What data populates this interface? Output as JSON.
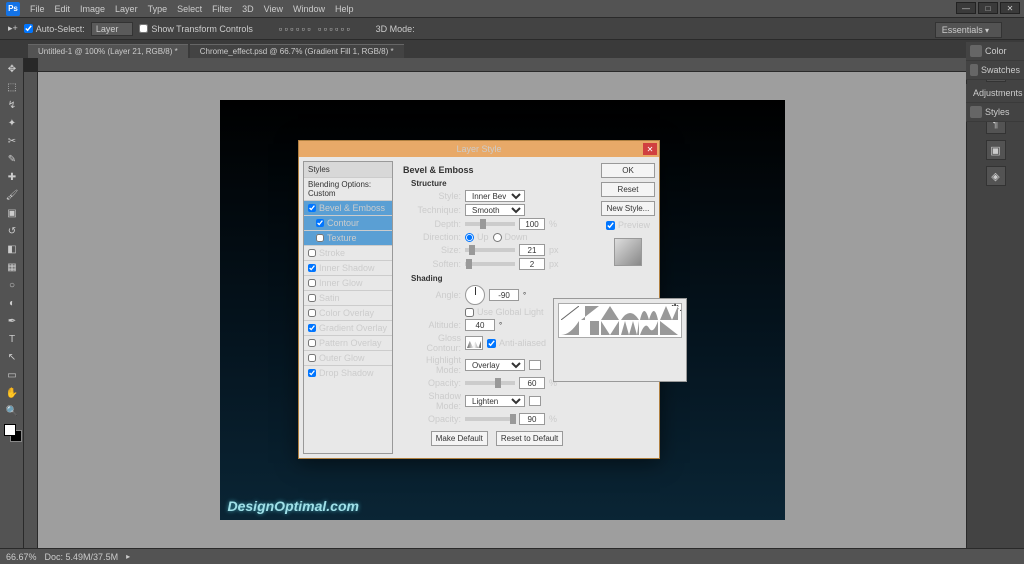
{
  "app": {
    "name": "Ps"
  },
  "menu": [
    "File",
    "Edit",
    "Image",
    "Layer",
    "Type",
    "Select",
    "Filter",
    "3D",
    "View",
    "Window",
    "Help"
  ],
  "optbar": {
    "auto_select": "Auto-Select:",
    "target": "Layer",
    "show_transform": "Show Transform Controls",
    "mode_3d": "3D Mode:"
  },
  "tabs": [
    "Untitled-1 @ 100% (Layer 21, RGB/8) *",
    "Chrome_effect.psd @ 66.7% (Gradient Fill 1, RGB/8) *"
  ],
  "essentials": "Essentials",
  "panels": [
    "Color",
    "Swatches",
    "Adjustments",
    "Styles"
  ],
  "watermark": "DesignOptimal.com",
  "status": {
    "zoom": "66.67%",
    "doc": "Doc: 5.49M/37.5M"
  },
  "dialog": {
    "title": "Layer Style",
    "left_header": "Styles",
    "blending": "Blending Options: Custom",
    "items": [
      {
        "label": "Bevel & Emboss",
        "checked": true,
        "selected": true
      },
      {
        "label": "Contour",
        "checked": true,
        "indent": true
      },
      {
        "label": "Texture",
        "checked": false,
        "indent": true
      },
      {
        "label": "Stroke",
        "checked": false
      },
      {
        "label": "Inner Shadow",
        "checked": true
      },
      {
        "label": "Inner Glow",
        "checked": false
      },
      {
        "label": "Satin",
        "checked": false
      },
      {
        "label": "Color Overlay",
        "checked": false
      },
      {
        "label": "Gradient Overlay",
        "checked": true
      },
      {
        "label": "Pattern Overlay",
        "checked": false
      },
      {
        "label": "Outer Glow",
        "checked": false
      },
      {
        "label": "Drop Shadow",
        "checked": true
      }
    ],
    "section": "Bevel & Emboss",
    "structure_hdr": "Structure",
    "style_lbl": "Style:",
    "style_val": "Inner Bevel",
    "tech_lbl": "Technique:",
    "tech_val": "Smooth",
    "depth_lbl": "Depth:",
    "depth_val": "100",
    "depth_unit": "%",
    "dir_lbl": "Direction:",
    "dir_up": "Up",
    "dir_down": "Down",
    "size_lbl": "Size:",
    "size_val": "21",
    "size_unit": "px",
    "soften_lbl": "Soften:",
    "soften_val": "2",
    "soften_unit": "px",
    "shading_hdr": "Shading",
    "angle_lbl": "Angle:",
    "angle_val": "-90",
    "global": "Use Global Light",
    "alt_lbl": "Altitude:",
    "alt_val": "40",
    "gloss_lbl": "Gloss Contour:",
    "aa": "Anti-aliased",
    "hmode_lbl": "Highlight Mode:",
    "hmode_val": "Overlay",
    "hopac_lbl": "Opacity:",
    "hopac_val": "60",
    "hopac_unit": "%",
    "smode_lbl": "Shadow Mode:",
    "smode_val": "Lighten",
    "sopac_lbl": "Opacity:",
    "sopac_val": "90",
    "sopac_unit": "%",
    "make_default": "Make Default",
    "reset_default": "Reset to Default",
    "ok": "OK",
    "reset": "Reset",
    "new_style": "New Style...",
    "preview": "Preview"
  }
}
